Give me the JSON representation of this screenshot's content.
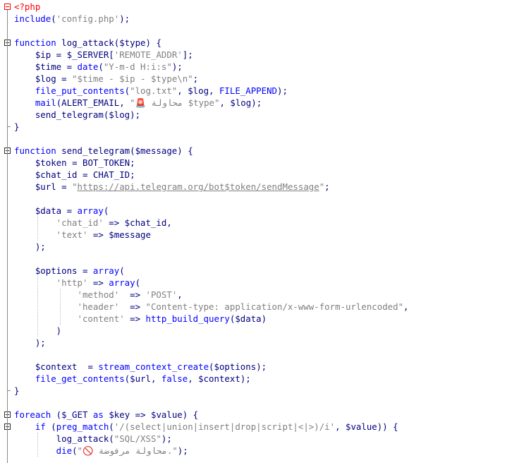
{
  "editor": {
    "language": "php",
    "lines": [
      [
        {
          "t": "<?php",
          "c": "tag"
        }
      ],
      [
        {
          "t": "include",
          "c": "kw"
        },
        {
          "t": "(",
          "c": "op"
        },
        {
          "t": "'config.php'",
          "c": "str"
        },
        {
          "t": ");",
          "c": "op"
        }
      ],
      [],
      [
        {
          "t": "function",
          "c": "kw"
        },
        {
          "t": " log_attack",
          "c": "fn"
        },
        {
          "t": "(",
          "c": "op"
        },
        {
          "t": "$type",
          "c": "var"
        },
        {
          "t": ") {",
          "c": "op"
        }
      ],
      [
        {
          "t": "    $ip",
          "c": "var"
        },
        {
          "t": " = ",
          "c": "op"
        },
        {
          "t": "$_SERVER",
          "c": "var"
        },
        {
          "t": "[",
          "c": "op"
        },
        {
          "t": "'REMOTE_ADDR'",
          "c": "str"
        },
        {
          "t": "];",
          "c": "op"
        }
      ],
      [
        {
          "t": "    $time",
          "c": "var"
        },
        {
          "t": " = ",
          "c": "op"
        },
        {
          "t": "date",
          "c": "bi"
        },
        {
          "t": "(",
          "c": "op"
        },
        {
          "t": "\"Y-m-d H:i:s\"",
          "c": "str"
        },
        {
          "t": ");",
          "c": "op"
        }
      ],
      [
        {
          "t": "    $log",
          "c": "var"
        },
        {
          "t": " = ",
          "c": "op"
        },
        {
          "t": "\"$time - $ip - $type\\n\"",
          "c": "str"
        },
        {
          "t": ";",
          "c": "op"
        }
      ],
      [
        {
          "t": "    file_put_contents",
          "c": "bi"
        },
        {
          "t": "(",
          "c": "op"
        },
        {
          "t": "\"log.txt\"",
          "c": "str"
        },
        {
          "t": ", ",
          "c": "op"
        },
        {
          "t": "$log",
          "c": "var"
        },
        {
          "t": ", ",
          "c": "op"
        },
        {
          "t": "FILE_APPEND",
          "c": "bi"
        },
        {
          "t": ");",
          "c": "op"
        }
      ],
      [
        {
          "t": "    mail",
          "c": "bi"
        },
        {
          "t": "(ALERT_EMAIL, ",
          "c": "op"
        },
        {
          "t": "\"🚨 محاولة $type\"",
          "c": "str"
        },
        {
          "t": ", ",
          "c": "op"
        },
        {
          "t": "$log",
          "c": "var"
        },
        {
          "t": ");",
          "c": "op"
        }
      ],
      [
        {
          "t": "    send_telegram",
          "c": "txt"
        },
        {
          "t": "(",
          "c": "op"
        },
        {
          "t": "$log",
          "c": "var"
        },
        {
          "t": ");",
          "c": "op"
        }
      ],
      [
        {
          "t": "}",
          "c": "op"
        }
      ],
      [],
      [
        {
          "t": "function",
          "c": "kw"
        },
        {
          "t": " send_telegram",
          "c": "fn"
        },
        {
          "t": "(",
          "c": "op"
        },
        {
          "t": "$message",
          "c": "var"
        },
        {
          "t": ") {",
          "c": "op"
        }
      ],
      [
        {
          "t": "    $token",
          "c": "var"
        },
        {
          "t": " = BOT_TOKEN;",
          "c": "op"
        }
      ],
      [
        {
          "t": "    $chat_id",
          "c": "var"
        },
        {
          "t": " = CHAT_ID;",
          "c": "op"
        }
      ],
      [
        {
          "t": "    $url",
          "c": "var"
        },
        {
          "t": " = ",
          "c": "op"
        },
        {
          "t": "\"",
          "c": "str"
        },
        {
          "t": "https://api.telegram.org/bot$token/sendMessage",
          "c": "str url"
        },
        {
          "t": "\"",
          "c": "str"
        },
        {
          "t": ";",
          "c": "op"
        }
      ],
      [],
      [
        {
          "t": "    $data",
          "c": "var"
        },
        {
          "t": " = ",
          "c": "op"
        },
        {
          "t": "array",
          "c": "bi"
        },
        {
          "t": "(",
          "c": "op"
        }
      ],
      [
        {
          "t": "        'chat_id'",
          "c": "str"
        },
        {
          "t": " => ",
          "c": "op"
        },
        {
          "t": "$chat_id",
          "c": "var"
        },
        {
          "t": ",",
          "c": "op"
        }
      ],
      [
        {
          "t": "        'text'",
          "c": "str"
        },
        {
          "t": " => ",
          "c": "op"
        },
        {
          "t": "$message",
          "c": "var"
        }
      ],
      [
        {
          "t": "    );",
          "c": "op"
        }
      ],
      [],
      [
        {
          "t": "    $options",
          "c": "var"
        },
        {
          "t": " = ",
          "c": "op"
        },
        {
          "t": "array",
          "c": "bi"
        },
        {
          "t": "(",
          "c": "op"
        }
      ],
      [
        {
          "t": "        'http'",
          "c": "str"
        },
        {
          "t": " => ",
          "c": "op"
        },
        {
          "t": "array",
          "c": "bi"
        },
        {
          "t": "(",
          "c": "op"
        }
      ],
      [
        {
          "t": "            'method'",
          "c": "str"
        },
        {
          "t": "  => ",
          "c": "op"
        },
        {
          "t": "'POST'",
          "c": "str"
        },
        {
          "t": ",",
          "c": "op"
        }
      ],
      [
        {
          "t": "            'header'",
          "c": "str"
        },
        {
          "t": "  => ",
          "c": "op"
        },
        {
          "t": "\"Content-type: application/x-www-form-urlencoded\"",
          "c": "str"
        },
        {
          "t": ",",
          "c": "op"
        }
      ],
      [
        {
          "t": "            'content'",
          "c": "str"
        },
        {
          "t": " => ",
          "c": "op"
        },
        {
          "t": "http_build_query",
          "c": "bi"
        },
        {
          "t": "(",
          "c": "op"
        },
        {
          "t": "$data",
          "c": "var"
        },
        {
          "t": ")",
          "c": "op"
        }
      ],
      [
        {
          "t": "        )",
          "c": "op"
        }
      ],
      [
        {
          "t": "    );",
          "c": "op"
        }
      ],
      [],
      [
        {
          "t": "    $context",
          "c": "var"
        },
        {
          "t": "  = ",
          "c": "op"
        },
        {
          "t": "stream_context_create",
          "c": "bi"
        },
        {
          "t": "(",
          "c": "op"
        },
        {
          "t": "$options",
          "c": "var"
        },
        {
          "t": ");",
          "c": "op"
        }
      ],
      [
        {
          "t": "    file_get_contents",
          "c": "bi"
        },
        {
          "t": "(",
          "c": "op"
        },
        {
          "t": "$url",
          "c": "var"
        },
        {
          "t": ", ",
          "c": "op"
        },
        {
          "t": "false",
          "c": "bi"
        },
        {
          "t": ", ",
          "c": "op"
        },
        {
          "t": "$context",
          "c": "var"
        },
        {
          "t": ");",
          "c": "op"
        }
      ],
      [
        {
          "t": "}",
          "c": "op"
        }
      ],
      [],
      [
        {
          "t": "foreach",
          "c": "kw"
        },
        {
          "t": " (",
          "c": "op"
        },
        {
          "t": "$_GET",
          "c": "var"
        },
        {
          "t": " ",
          "c": "op"
        },
        {
          "t": "as",
          "c": "kw"
        },
        {
          "t": " ",
          "c": "op"
        },
        {
          "t": "$key",
          "c": "var"
        },
        {
          "t": " => ",
          "c": "op"
        },
        {
          "t": "$value",
          "c": "var"
        },
        {
          "t": ") {",
          "c": "op"
        }
      ],
      [
        {
          "t": "    if",
          "c": "kw"
        },
        {
          "t": " (",
          "c": "op"
        },
        {
          "t": "preg_match",
          "c": "bi"
        },
        {
          "t": "(",
          "c": "op"
        },
        {
          "t": "'/(select|union|insert|drop|script|<|>)/i'",
          "c": "str"
        },
        {
          "t": ", ",
          "c": "op"
        },
        {
          "t": "$value",
          "c": "var"
        },
        {
          "t": ")) {",
          "c": "op"
        }
      ],
      [
        {
          "t": "        log_attack",
          "c": "txt"
        },
        {
          "t": "(",
          "c": "op"
        },
        {
          "t": "\"SQL/XSS\"",
          "c": "str"
        },
        {
          "t": ");",
          "c": "op"
        }
      ],
      [
        {
          "t": "        die",
          "c": "bi"
        },
        {
          "t": "(",
          "c": "op"
        },
        {
          "t": "\"🚫 محاولة مرفوضة.\"",
          "c": "str"
        },
        {
          "t": ");",
          "c": "op"
        }
      ]
    ]
  }
}
